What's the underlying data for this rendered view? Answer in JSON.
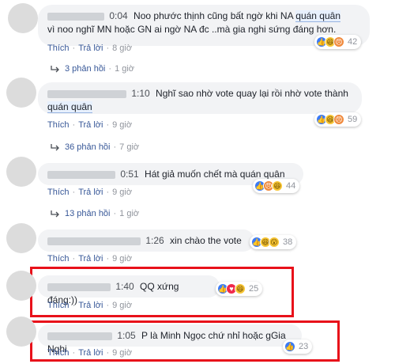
{
  "comments": [
    {
      "time": "0:04",
      "text_pre": "Noo phước thịnh cũng bất ngờ khi NA ",
      "text_hl": "quán quân",
      "text_post": "vì noo nghĩ MN hoặc GN ai ngờ NA đc ..mà gia nghi sứng đáng hơn.",
      "reaction_count": "42",
      "like": "Thích",
      "reply": "Trả lời",
      "ago": "8 giờ",
      "replies": "3 phản hồi",
      "replies_ago": "1 giờ"
    },
    {
      "time": "1:10",
      "text_pre": "Nghĩ sao nhờ vote quay lại rồi nhờ vote thành",
      "text_hl": "quán quân",
      "reaction_count": "59",
      "like": "Thích",
      "reply": "Trả lời",
      "ago": "9 giờ",
      "replies": "36 phản hồi",
      "replies_ago": "7 giờ"
    },
    {
      "time": "0:51",
      "text_pre": "Hát giả muốn chết mà quán quân",
      "reaction_count": "44",
      "like": "Thích",
      "reply": "Trả lời",
      "ago": "9 giờ",
      "replies": "13 phản hồi",
      "replies_ago": "1 giờ"
    },
    {
      "time": "1:26",
      "text_pre": "xin chào the vote",
      "reaction_count": "38",
      "like": "Thích",
      "reply": "Trả lời",
      "ago": "9 giờ"
    },
    {
      "time": "1:40",
      "text_pre": "QQ xứng đáng:))",
      "reaction_count": "25",
      "like": "Thích",
      "reply": "Trả lời",
      "ago": "9 giờ"
    },
    {
      "time": "1:05",
      "text_pre": "P là Minh Ngọc chứ nhỉ hoặc gGia Nghi",
      "reaction_count": "23",
      "like": "Thích",
      "reply": "Trả lời",
      "ago": "9 giờ"
    }
  ],
  "colors": {
    "highlight_box": "#e8111a",
    "link": "#385898",
    "like": "#3b7bf5"
  },
  "icons": {
    "like": "like-reaction-icon",
    "love": "love-reaction-icon",
    "haha": "haha-reaction-icon",
    "angry": "angry-reaction-icon",
    "reply_arrow": "reply-arrow-icon"
  }
}
